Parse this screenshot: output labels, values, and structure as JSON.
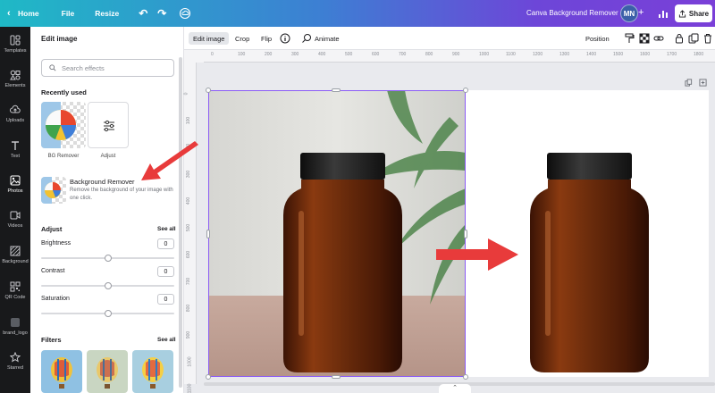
{
  "topbar": {
    "home": "Home",
    "file": "File",
    "resize": "Resize",
    "doc_title": "Canva Background Remover",
    "avatar": "MN",
    "plus": "+",
    "share": "Share"
  },
  "rail": {
    "items": [
      {
        "label": "Templates",
        "icon": "templates-icon"
      },
      {
        "label": "Elements",
        "icon": "elements-icon"
      },
      {
        "label": "Uploads",
        "icon": "uploads-icon"
      },
      {
        "label": "Text",
        "icon": "text-icon"
      },
      {
        "label": "Photos",
        "icon": "photos-icon"
      },
      {
        "label": "Videos",
        "icon": "videos-icon"
      },
      {
        "label": "Background",
        "icon": "background-icon"
      },
      {
        "label": "QR Code",
        "icon": "qr-code-icon"
      },
      {
        "label": "brand_logo",
        "icon": "brand-logo-icon"
      },
      {
        "label": "Starred",
        "icon": "star-icon"
      }
    ],
    "active_index": 4
  },
  "panel": {
    "title": "Edit image",
    "search_placeholder": "Search effects",
    "recently_used": "Recently used",
    "recent": [
      {
        "label": "BG Remover"
      },
      {
        "label": "Adjust"
      }
    ],
    "bg_remover": {
      "title": "Background Remover",
      "desc": "Remove the background of your image with one click."
    },
    "adjust": {
      "title": "Adjust",
      "see_all": "See all",
      "controls": [
        {
          "label": "Brightness",
          "value": "0",
          "level": 0.5
        },
        {
          "label": "Contrast",
          "value": "0",
          "level": 0.5
        },
        {
          "label": "Saturation",
          "value": "0",
          "level": 0.5
        }
      ]
    },
    "filters": {
      "title": "Filters",
      "see_all": "See all"
    }
  },
  "context_toolbar": {
    "edit_image": "Edit image",
    "crop": "Crop",
    "flip": "Flip",
    "animate": "Animate",
    "position": "Position"
  },
  "ruler": {
    "top": [
      "0",
      "100",
      "200",
      "300",
      "400",
      "500",
      "600",
      "700",
      "800",
      "900",
      "1000",
      "1100",
      "1200",
      "1300",
      "1400",
      "1500",
      "1600",
      "1700",
      "1800"
    ],
    "left": [
      "0",
      "100",
      "200",
      "300",
      "400",
      "500",
      "600",
      "700",
      "800",
      "900",
      "1000",
      "1100"
    ]
  },
  "colors": {
    "accent": "#8b5cf6",
    "arrow": "#e83b3b",
    "bottle": "#6b2c0c",
    "cap": "#1e1e1e",
    "rail_bg": "#18191b"
  }
}
